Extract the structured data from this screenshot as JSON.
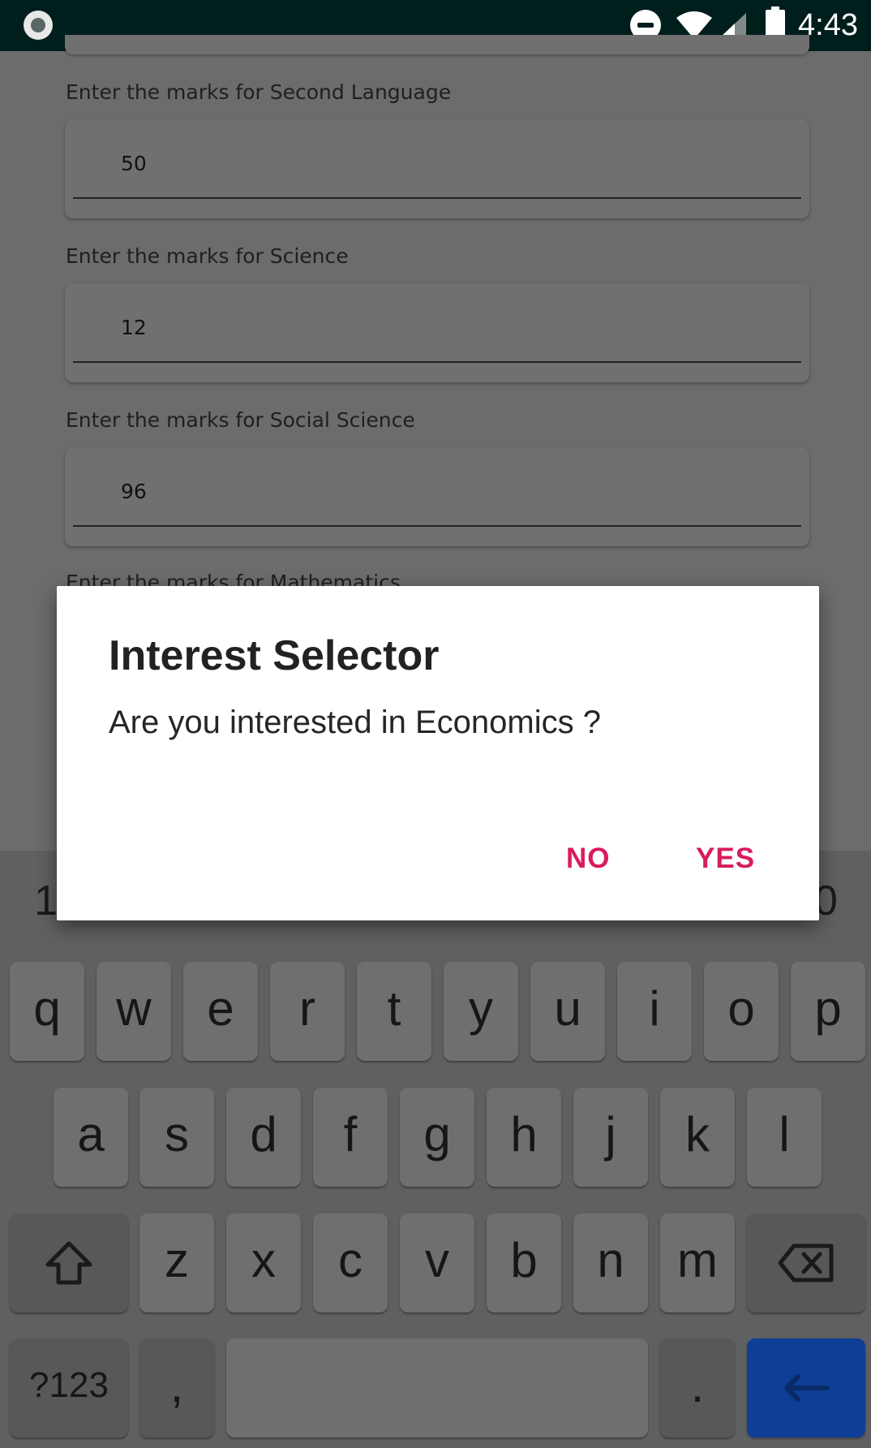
{
  "status_bar": {
    "time": "4:43",
    "icons": [
      "app-notification-icon",
      "do-not-disturb-icon",
      "wifi-icon",
      "signal-icon",
      "battery-icon"
    ]
  },
  "form": {
    "fields": [
      {
        "label": "Enter the marks for Second Language",
        "value": "50"
      },
      {
        "label": "Enter the marks for Science",
        "value": "12"
      },
      {
        "label": "Enter the marks for Social Science",
        "value": "96"
      }
    ],
    "partial_label": "Enter the marks for Mathematics"
  },
  "dialog": {
    "title": "Interest Selector",
    "message": "Are you interested in Economics ?",
    "negative_button": "NO",
    "positive_button": "YES",
    "accent_color": "#d81b60"
  },
  "keyboard": {
    "number_row_visible": [
      "1",
      "0"
    ],
    "row1": [
      "q",
      "w",
      "e",
      "r",
      "t",
      "y",
      "u",
      "i",
      "o",
      "p"
    ],
    "row2": [
      "a",
      "s",
      "d",
      "f",
      "g",
      "h",
      "j",
      "k",
      "l"
    ],
    "row3": [
      "z",
      "x",
      "c",
      "v",
      "b",
      "n",
      "m"
    ],
    "symbols_key": "?123",
    "comma_key": ",",
    "period_key": ".",
    "enter_color": "#0e3e96"
  }
}
